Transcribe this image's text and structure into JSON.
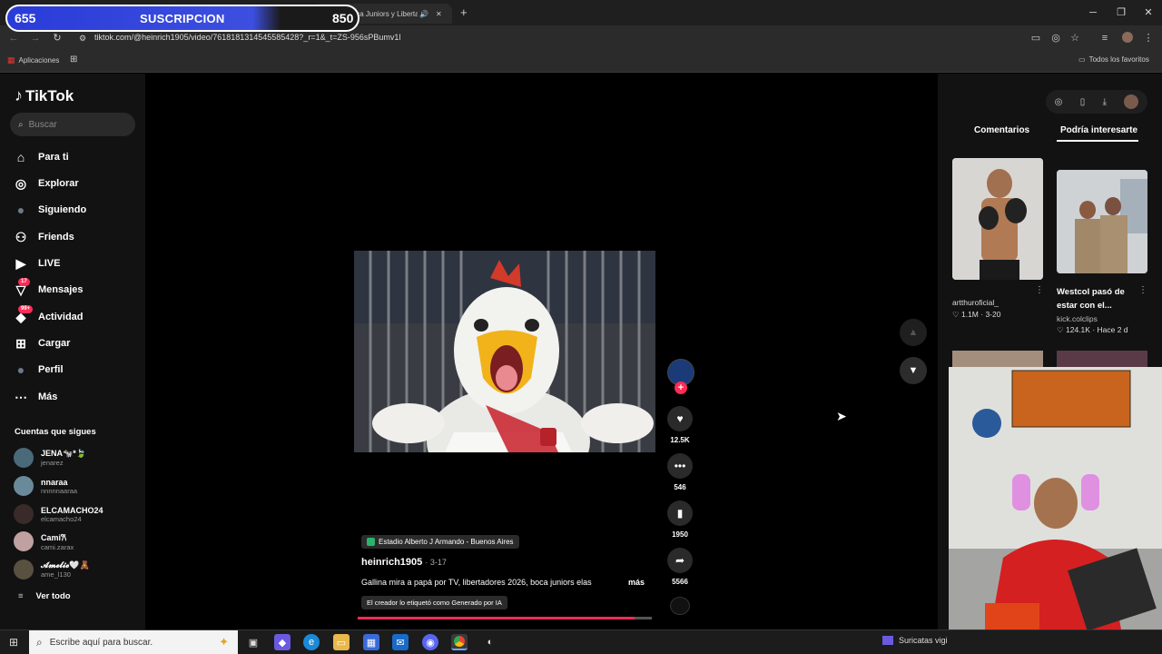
{
  "overlay": {
    "left_count": "655",
    "label": "SUSCRIPCION",
    "right_count": "850"
  },
  "browser": {
    "tab_title": "(99) Boca Juniors y Libertad",
    "url": "tiktok.com/@heinrich1905/video/7618181314545585428?_r=1&_t=ZS-956sPBumv1l",
    "bookmark_apps": "Aplicaciones",
    "bookmark_all": "Todos los favoritos"
  },
  "sidebar": {
    "brand": "TikTok",
    "search_placeholder": "Buscar",
    "items": [
      {
        "label": "Para ti",
        "icon": "home-icon"
      },
      {
        "label": "Explorar",
        "icon": "compass-icon"
      },
      {
        "label": "Siguiendo",
        "icon": "following-avatar-icon"
      },
      {
        "label": "Friends",
        "icon": "friends-icon"
      },
      {
        "label": "LIVE",
        "icon": "live-icon"
      },
      {
        "label": "Mensajes",
        "icon": "messages-icon",
        "badge": "17"
      },
      {
        "label": "Actividad",
        "icon": "activity-icon",
        "badge": "99+"
      },
      {
        "label": "Cargar",
        "icon": "upload-icon"
      },
      {
        "label": "Perfil",
        "icon": "profile-avatar-icon"
      },
      {
        "label": "Más",
        "icon": "more-icon"
      }
    ],
    "following_title": "Cuentas que sigues",
    "following": [
      {
        "name": "JENA🐄*🍃",
        "handle": "jenarez"
      },
      {
        "name": "nnaraa",
        "handle": "nnnnnaaraa"
      },
      {
        "name": "ELCAMACHO24",
        "handle": "elcamacho24"
      },
      {
        "name": "Cami𐙚",
        "handle": "cami.zarax"
      },
      {
        "name": "𝓐𝓶𝓮𝓵𝓲𝓮🤍🧸",
        "handle": "ame_l130"
      }
    ],
    "see_all": "Ver todo"
  },
  "video": {
    "likes": "12.5K",
    "comments": "546",
    "saves": "1950",
    "shares": "5566",
    "location": "Estadio Alberto J Armando - Buenos Aires",
    "author": "heinrich1905",
    "date": "· 3-17",
    "caption": "Gallina mira a papá por TV, libertadores 2026, boca juniors elas",
    "more": "más",
    "ai_tag": "El creador lo etiquetó como Generado por IA",
    "progress": 0.94
  },
  "right_panel": {
    "tab_comments": "Comentarios",
    "tab_suggested": "Podría interesarte",
    "cards": [
      {
        "title": "artthuroficial_",
        "likes": "1.1M",
        "date": "· 3-20"
      },
      {
        "title": "Westcol pasó de estar con el...",
        "author": "kick.colclips",
        "likes": "124.1K",
        "date": "· Hace 2 d"
      }
    ]
  },
  "taskbar": {
    "search_placeholder": "Escribe aquí para buscar.",
    "tray_text": "Suricatas vigi"
  },
  "colors": {
    "accent": "#fe2c55",
    "background": "#000000",
    "sidebar": "#121212"
  }
}
